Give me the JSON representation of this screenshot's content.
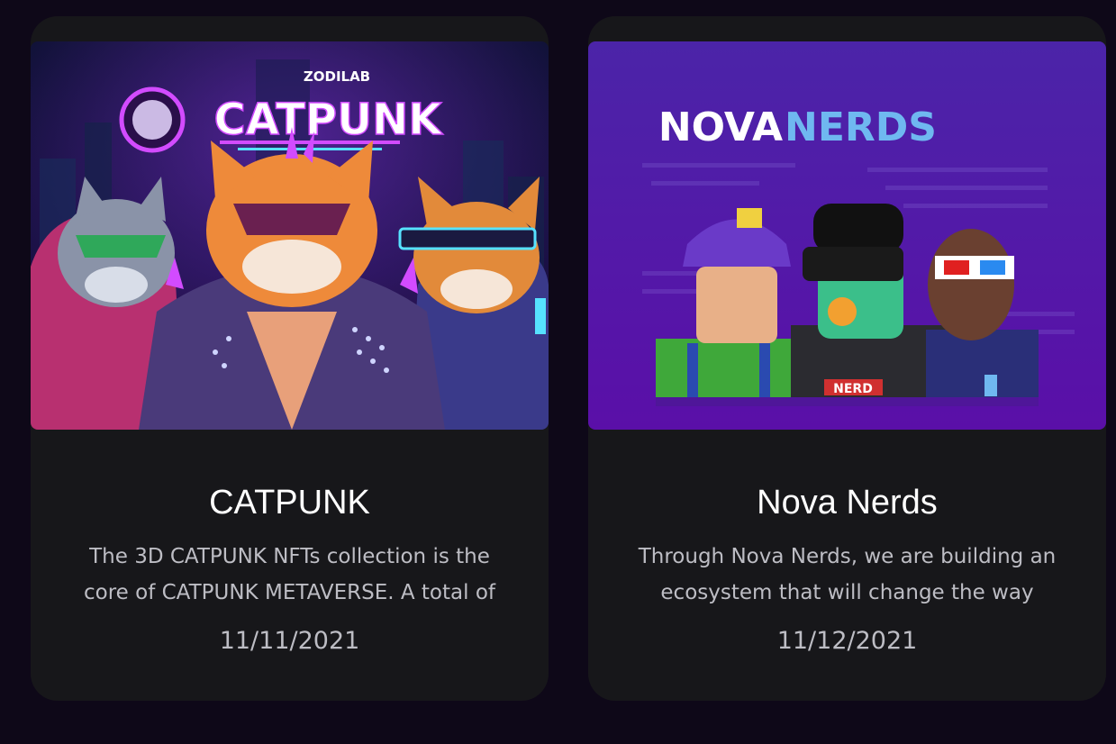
{
  "cards": [
    {
      "title": "CATPUNK",
      "description": "The 3D CATPUNK NFTs collection is the core of CATPUNK METAVERSE. A total of",
      "date": "11/11/2021",
      "image": {
        "brand": "ZODILAB",
        "logo_text": "CATPUNK"
      }
    },
    {
      "title": "Nova Nerds",
      "description": "Through Nova Nerds, we are building an ecosystem that will change the way",
      "date": "11/12/2021",
      "image": {
        "logo_part1": "NOVA",
        "logo_part2": "NERDS",
        "badge_text": "NERD"
      }
    }
  ],
  "colors": {
    "page_bg": "#0e0818",
    "card_bg": "#17171a",
    "title": "#ffffff",
    "muted_text": "#bdbdc4",
    "nova_accent": "#6fb8f0"
  }
}
